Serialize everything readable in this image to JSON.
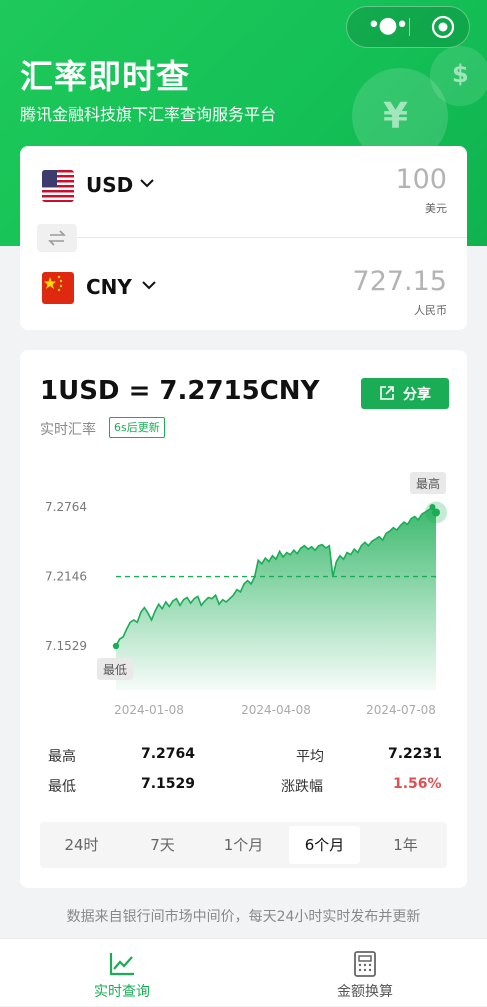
{
  "capsule": {
    "menu_icon": "more-dots-icon",
    "close_icon": "target-close-icon"
  },
  "header": {
    "title": "汇率即时查",
    "subtitle": "腾讯金融科技旗下汇率查询服务平台"
  },
  "converter": {
    "from": {
      "code": "USD",
      "amount": "100",
      "unit": "美元",
      "flag": "us-flag-icon"
    },
    "to": {
      "code": "CNY",
      "amount": "727.15",
      "unit": "人民币",
      "flag": "cn-flag-icon"
    },
    "swap_icon": "swap-arrows-icon"
  },
  "rate_card": {
    "rate": "1USD = 7.2715CNY",
    "label": "实时汇率",
    "countdown": "6s后更新",
    "share_label": "分享",
    "high_marker": "最高",
    "low_marker": "最低"
  },
  "chart_data": {
    "type": "area",
    "x_ticks": [
      "2024-01-08",
      "2024-04-08",
      "2024-07-08"
    ],
    "y_ticks": [
      "7.2764",
      "7.2146",
      "7.1529"
    ],
    "ylim": [
      7.1529,
      7.2764
    ],
    "reference_line": 7.2146,
    "series": [
      {
        "values": [
          7.1529,
          7.159,
          7.161,
          7.168,
          7.174,
          7.176,
          7.174,
          7.183,
          7.187,
          7.182,
          7.176,
          7.184,
          7.19,
          7.186,
          7.192,
          7.188,
          7.193,
          7.195,
          7.189,
          7.194,
          7.196,
          7.191,
          7.195,
          7.197,
          7.189,
          7.193,
          7.196,
          7.195,
          7.198,
          7.19,
          7.194,
          7.192,
          7.195,
          7.198,
          7.203,
          7.201,
          7.208,
          7.211,
          7.208,
          7.2146,
          7.229,
          7.226,
          7.231,
          7.228,
          7.233,
          7.23,
          7.237,
          7.232,
          7.236,
          7.234,
          7.238,
          7.235,
          7.24,
          7.242,
          7.239,
          7.241,
          7.238,
          7.242,
          7.243,
          7.24,
          7.242,
          7.2146,
          7.228,
          7.233,
          7.23,
          7.236,
          7.234,
          7.239,
          7.236,
          7.242,
          7.245,
          7.242,
          7.246,
          7.248,
          7.25,
          7.247,
          7.253,
          7.255,
          7.258,
          7.256,
          7.26,
          7.263,
          7.261,
          7.266,
          7.268,
          7.265,
          7.27,
          7.272,
          7.274,
          7.2764,
          7.2715
        ]
      }
    ],
    "grid": false,
    "fill_color": "#1aad55",
    "line_color": "#1aad55",
    "reference_color": "#1aad55"
  },
  "stats": {
    "high_label": "最高",
    "high_value": "7.2764",
    "low_label": "最低",
    "low_value": "7.1529",
    "avg_label": "平均",
    "avg_value": "7.2231",
    "change_label": "涨跌幅",
    "change_value": "1.56%",
    "change_color": "#e05050"
  },
  "periods": [
    {
      "label": "24时",
      "active": false
    },
    {
      "label": "7天",
      "active": false
    },
    {
      "label": "1个月",
      "active": false
    },
    {
      "label": "6个月",
      "active": true
    },
    {
      "label": "1年",
      "active": false
    }
  ],
  "footer_note": "数据来自银行间市场中间价，每天24小时实时发布并更新",
  "tabbar": [
    {
      "label": "实时查询",
      "icon": "trend-chart-icon",
      "active": true
    },
    {
      "label": "金额换算",
      "icon": "calculator-icon",
      "active": false
    }
  ],
  "colors": {
    "brand": "#1aad55",
    "header": "#14c157"
  }
}
